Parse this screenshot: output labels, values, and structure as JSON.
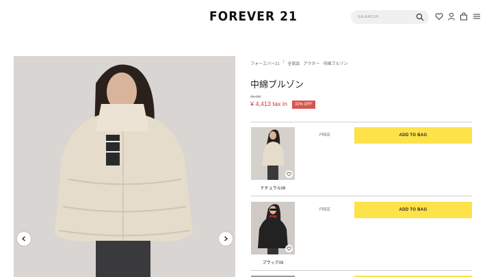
{
  "header": {
    "logo": "FOREVER 21",
    "search_placeholder": "SEARCH"
  },
  "breadcrumb": [
    "フォーエバー21",
    "/",
    "全商品",
    "アウター",
    "中綿ブルゾン"
  ],
  "product": {
    "title": "中綿ブルゾン",
    "old_price": "¥6,490",
    "price": "¥ 4,413  tax in",
    "discount": "32% OFF"
  },
  "variants": [
    {
      "name": "ナチュラル08",
      "size": "FREE",
      "button": "ADD TO BAG",
      "color": "#e6dccb"
    },
    {
      "name": "ブラック09",
      "size": "FREE",
      "button": "ADD TO BAG",
      "color": "#222222"
    }
  ],
  "colors": {
    "accent_yellow": "#fde24a",
    "sale_red": "#d23b3b"
  }
}
